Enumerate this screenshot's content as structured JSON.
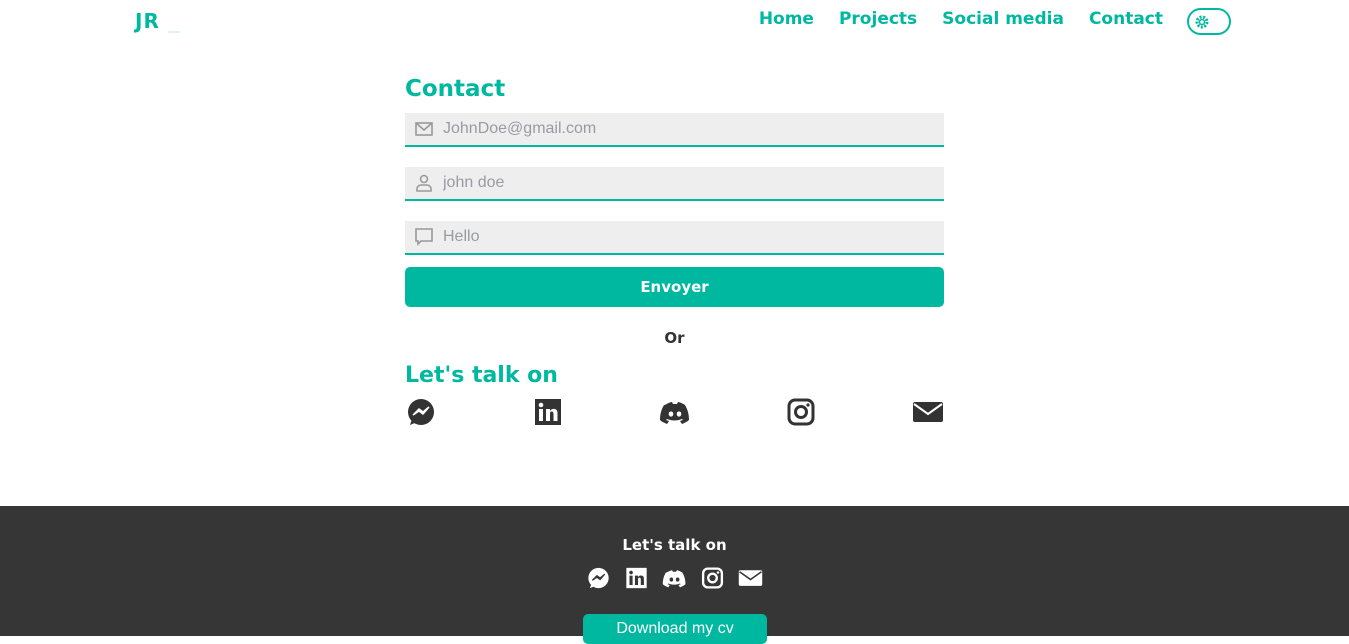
{
  "header": {
    "logo": "JR",
    "nav": [
      "Home",
      "Projects",
      "Social media",
      "Contact"
    ]
  },
  "contact": {
    "title": "Contact",
    "fields": [
      {
        "icon": "envelope-icon",
        "placeholder": "JohnDoe@gmail.com"
      },
      {
        "icon": "user-icon",
        "placeholder": "john doe"
      },
      {
        "icon": "message-icon",
        "placeholder": "Hello"
      }
    ],
    "submit": "Envoyer",
    "or": "Or",
    "talk_title": "Let's talk on",
    "socials": [
      "messenger-icon",
      "linkedin-icon",
      "discord-icon",
      "instagram-icon",
      "mail-icon"
    ]
  },
  "footer": {
    "title": "Let's talk on",
    "cv_button": "Download my cv"
  },
  "colors": {
    "accent": "#00b89f",
    "footer_bg": "#363636"
  }
}
